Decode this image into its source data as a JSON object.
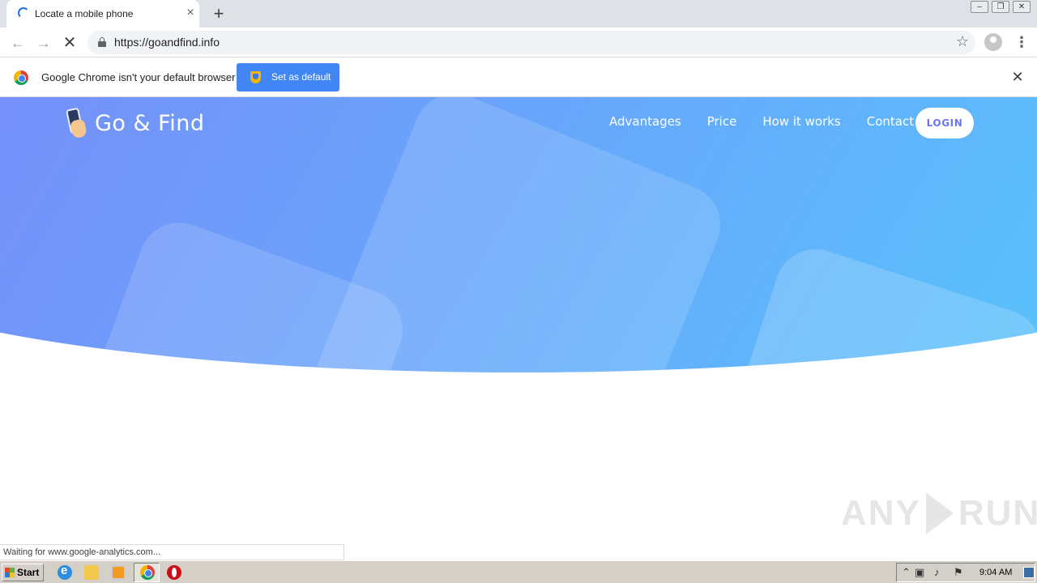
{
  "browser": {
    "tab_title": "Locate a mobile phone",
    "tab_close": "×",
    "new_tab": "+",
    "url": "https://goandfind.info",
    "window_controls": [
      "–",
      "❐",
      "✕"
    ]
  },
  "infobar": {
    "message": "Google Chrome isn't your default browser",
    "button_label": "Set as default",
    "close": "✕"
  },
  "site": {
    "logo_text": "Go & Find",
    "nav": [
      {
        "label": "Advantages"
      },
      {
        "label": "Price"
      },
      {
        "label": "How it works"
      },
      {
        "label": "Contact"
      }
    ],
    "login_label": "LOGIN",
    "colors": {
      "gradient_start": "#7b86f8",
      "gradient_end": "#55c8fb",
      "login_text": "#6b75f2"
    }
  },
  "status_text": "Waiting for www.google-analytics.com...",
  "watermark": {
    "left": "ANY",
    "right": "RUN"
  },
  "taskbar": {
    "start_label": "Start",
    "clock": "9:04 AM"
  }
}
